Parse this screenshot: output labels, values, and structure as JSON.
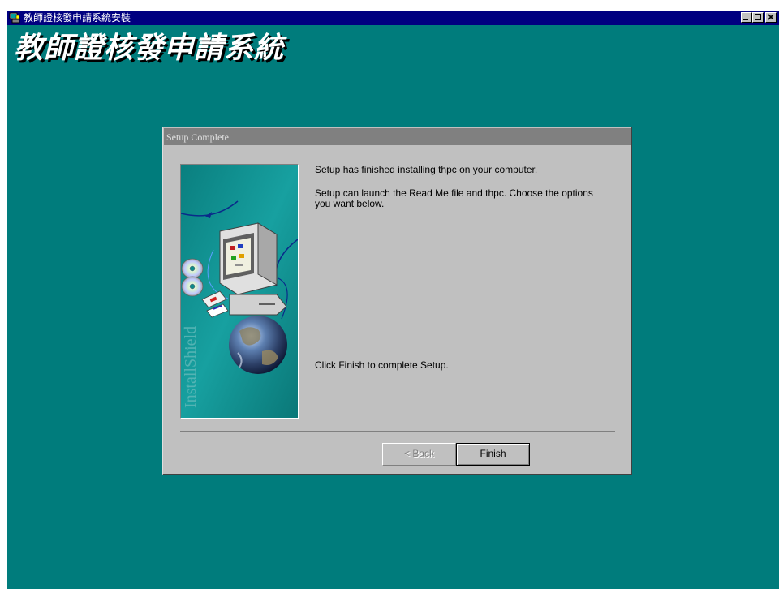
{
  "window": {
    "title": "教師證核發申請系統安裝",
    "banner": "教師證核發申請系統"
  },
  "dialog": {
    "title": "Setup Complete",
    "message_finished": "Setup has finished installing thpc on your computer.",
    "message_launch": "Setup can launch the Read Me file and thpc.  Choose the options you want below.",
    "message_finish": "Click Finish to complete Setup.",
    "art_watermark": "InstallShield",
    "back_button": "< Back",
    "finish_button": "Finish"
  },
  "colors": {
    "desktop": "#007c7c",
    "titlebar": "#000080",
    "dialog_face": "#c0c0c0"
  }
}
